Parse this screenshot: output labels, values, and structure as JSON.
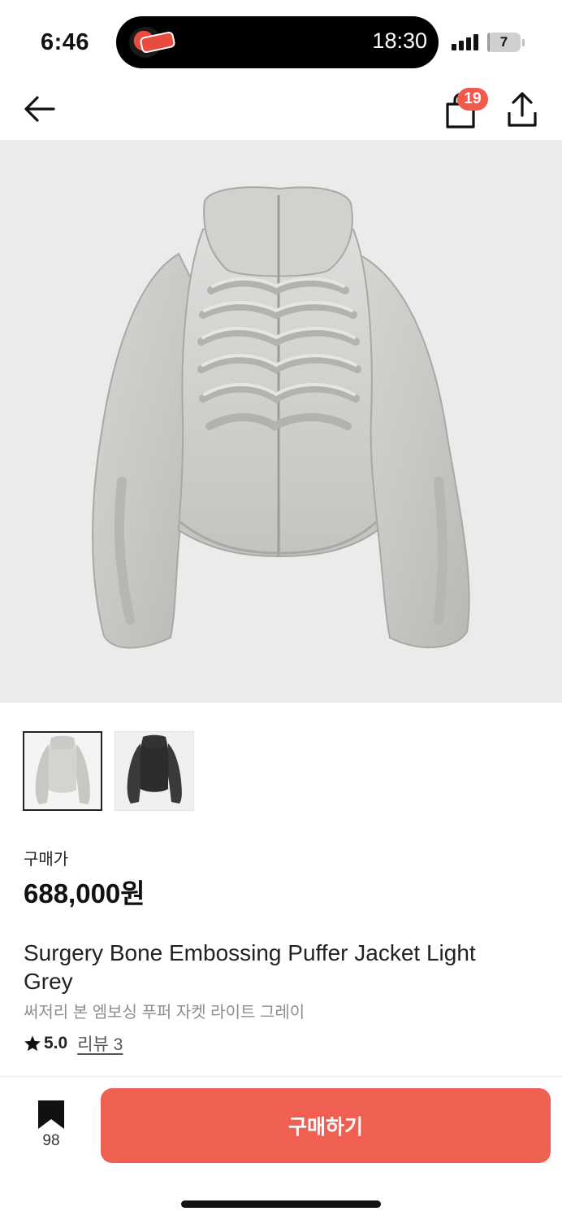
{
  "status_bar": {
    "time": "6:46",
    "live_activity_timer": "18:30",
    "battery_level": "7",
    "battery_fraction": 0.07
  },
  "nav": {
    "back_icon": "arrow-left-icon",
    "bag_icon": "shopping-bag-icon",
    "bag_count": "19",
    "share_icon": "share-icon"
  },
  "product": {
    "hero_image": "light-grey-puffer-jacket",
    "thumbnails": [
      {
        "variant": "light-grey",
        "selected": true
      },
      {
        "variant": "black",
        "selected": false
      }
    ],
    "price_label": "구매가",
    "price": "688,000원",
    "title": "Surgery Bone Embossing Puffer Jacket Light Grey",
    "subtitle": "써저리 본 엠보싱 푸퍼 자켓 라이트 그레이",
    "rating": "5.0",
    "review_link": "리뷰 3"
  },
  "bottom_bar": {
    "bookmark_icon": "bookmark-icon",
    "bookmark_count": "98",
    "buy_label": "구매하기"
  },
  "colors": {
    "accent": "#ef5f52",
    "badge": "#ef5a4d",
    "hero_background": "#ebebeb"
  }
}
